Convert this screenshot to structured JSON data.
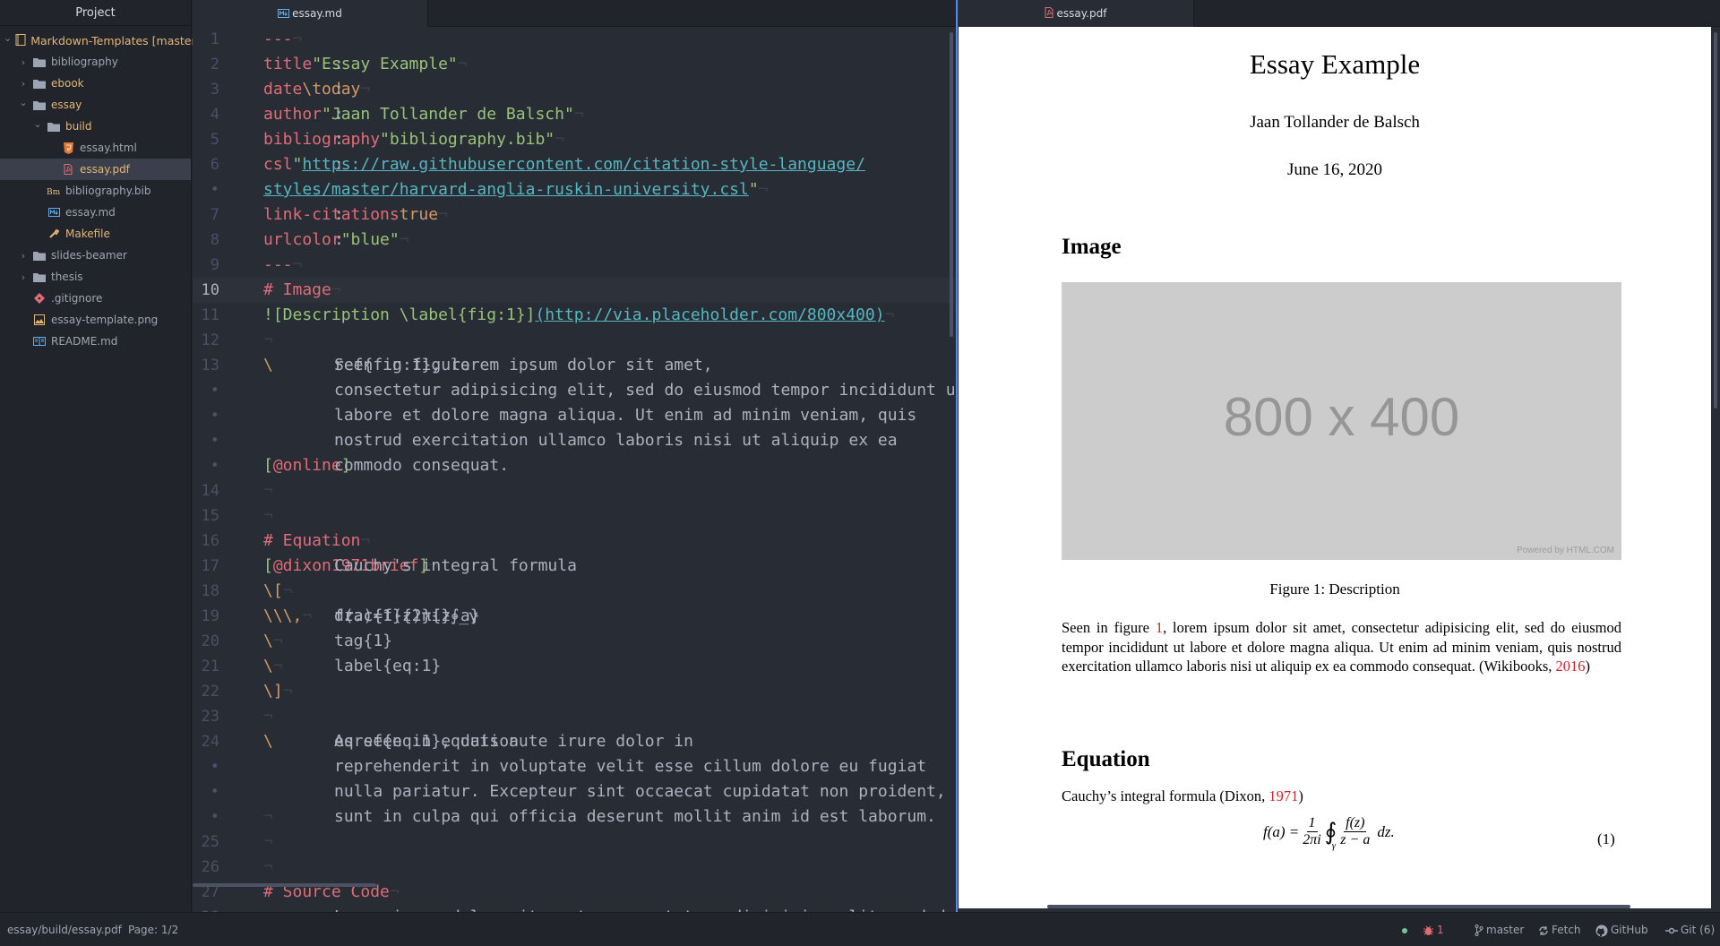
{
  "sidebar": {
    "title": "Project",
    "tree": [
      {
        "label": "Markdown-Templates [master]",
        "type": "repo",
        "level": 0,
        "chevron": "open",
        "style": "root"
      },
      {
        "label": "bibliography",
        "type": "folder",
        "level": 1,
        "chevron": "closed"
      },
      {
        "label": "ebook",
        "type": "folder",
        "level": 1,
        "chevron": "closed",
        "style": "orange"
      },
      {
        "label": "essay",
        "type": "folder",
        "level": 1,
        "chevron": "open",
        "style": "orange"
      },
      {
        "label": "build",
        "type": "folder",
        "level": 2,
        "chevron": "open",
        "style": "orange"
      },
      {
        "label": "essay.html",
        "type": "html",
        "level": 3
      },
      {
        "label": "essay.pdf",
        "type": "pdf",
        "level": 3,
        "selected": true,
        "style": "orange"
      },
      {
        "label": "bibliography.bib",
        "type": "bib",
        "level": 2
      },
      {
        "label": "essay.md",
        "type": "md",
        "level": 2
      },
      {
        "label": "Makefile",
        "type": "make",
        "level": 2,
        "style": "orange"
      },
      {
        "label": "slides-beamer",
        "type": "folder",
        "level": 1,
        "chevron": "closed"
      },
      {
        "label": "thesis",
        "type": "folder",
        "level": 1,
        "chevron": "closed"
      },
      {
        "label": ".gitignore",
        "type": "git",
        "level": 1
      },
      {
        "label": "essay-template.png",
        "type": "png",
        "level": 1
      },
      {
        "label": "README.md",
        "type": "readme",
        "level": 1
      }
    ]
  },
  "editor": {
    "tab_label": "essay.md",
    "active_line": "10",
    "lines": [
      {
        "n": "1",
        "seg": [
          [
            "head",
            "---"
          ],
          [
            "eol",
            "¬"
          ]
        ]
      },
      {
        "n": "2",
        "seg": [
          [
            "kw",
            "title"
          ],
          [
            "txt",
            ": "
          ],
          [
            "str",
            "\"Essay Example\""
          ],
          [
            "eol",
            "¬"
          ]
        ]
      },
      {
        "n": "3",
        "seg": [
          [
            "kw",
            "date"
          ],
          [
            "txt",
            ": "
          ],
          [
            "num",
            "\\today"
          ],
          [
            "eol",
            "¬"
          ]
        ]
      },
      {
        "n": "4",
        "seg": [
          [
            "kw",
            "author"
          ],
          [
            "txt",
            ": "
          ],
          [
            "str",
            "\"Jaan Tollander de Balsch\""
          ],
          [
            "eol",
            "¬"
          ]
        ]
      },
      {
        "n": "5",
        "seg": [
          [
            "kw",
            "bibliography"
          ],
          [
            "txt",
            ": "
          ],
          [
            "str",
            "\"bibliography.bib\""
          ],
          [
            "eol",
            "¬"
          ]
        ]
      },
      {
        "n": "6",
        "seg": [
          [
            "kw",
            "csl"
          ],
          [
            "txt",
            ": "
          ],
          [
            "str",
            "\""
          ],
          [
            "link",
            "https://raw.githubusercontent.com/citation-style-language/"
          ]
        ]
      },
      {
        "n": "•",
        "seg": [
          [
            "link",
            "styles/master/harvard-anglia-ruskin-university.csl"
          ],
          [
            "str",
            "\""
          ],
          [
            "eol",
            "¬"
          ]
        ]
      },
      {
        "n": "7",
        "seg": [
          [
            "kw",
            "link-citations"
          ],
          [
            "txt",
            ": "
          ],
          [
            "num",
            "true"
          ],
          [
            "eol",
            "¬"
          ]
        ]
      },
      {
        "n": "8",
        "seg": [
          [
            "kw",
            "urlcolor"
          ],
          [
            "txt",
            ": "
          ],
          [
            "str",
            "\"blue\""
          ],
          [
            "eol",
            "¬"
          ]
        ]
      },
      {
        "n": "9",
        "seg": [
          [
            "head",
            "---"
          ],
          [
            "eol",
            "¬"
          ]
        ]
      },
      {
        "n": "10",
        "seg": [
          [
            "head",
            "# Image"
          ],
          [
            "eol",
            "¬"
          ]
        ]
      },
      {
        "n": "11",
        "seg": [
          [
            "brk",
            "![Description \\label{fig:1}]"
          ],
          [
            "link",
            "(http://via.placeholder.com/800x400)"
          ],
          [
            "eol",
            "¬"
          ]
        ]
      },
      {
        "n": "12",
        "seg": [
          [
            "eol",
            "¬"
          ]
        ]
      },
      {
        "n": "13",
        "seg": [
          [
            "txt",
            "Seen in figure "
          ],
          [
            "esc",
            "\\"
          ],
          [
            "txt",
            "ref{fig:1}, lorem ipsum dolor sit amet,"
          ]
        ]
      },
      {
        "n": "•",
        "seg": [
          [
            "txt",
            "consectetur adipisicing elit, sed do eiusmod tempor incididunt ut"
          ]
        ]
      },
      {
        "n": "•",
        "seg": [
          [
            "txt",
            "labore et dolore magna aliqua. Ut enim ad minim veniam, quis"
          ]
        ]
      },
      {
        "n": "•",
        "seg": [
          [
            "txt",
            "nostrud exercitation ullamco laboris nisi ut aliquip ex ea"
          ]
        ]
      },
      {
        "n": "•",
        "seg": [
          [
            "txt",
            "commodo consequat. "
          ],
          [
            "brk",
            "["
          ],
          [
            "cite",
            "@online"
          ],
          [
            "brk",
            "]"
          ],
          [
            "eol",
            "¬"
          ]
        ]
      },
      {
        "n": "14",
        "seg": [
          [
            "eol",
            "¬"
          ]
        ]
      },
      {
        "n": "15",
        "seg": [
          [
            "eol",
            "¬"
          ]
        ]
      },
      {
        "n": "16",
        "seg": [
          [
            "head",
            "# Equation"
          ],
          [
            "eol",
            "¬"
          ]
        ]
      },
      {
        "n": "17",
        "seg": [
          [
            "txt",
            "Cauchy's integral formula "
          ],
          [
            "brk",
            "["
          ],
          [
            "cite",
            "@dixon1971brief"
          ],
          [
            "brk",
            "]"
          ],
          [
            "eol",
            "¬"
          ]
        ]
      },
      {
        "n": "18",
        "seg": [
          [
            "esc",
            "\\["
          ],
          [
            "eol",
            "¬"
          ]
        ]
      },
      {
        "n": "19",
        "seg": [
          [
            "txt",
            "f(a)="
          ],
          [
            "esc",
            "\\"
          ],
          [
            "txt",
            "frac{1}{2πi}∮_γ"
          ],
          [
            "esc",
            "\\"
          ],
          [
            "txt",
            "frac{f(z)}{z-a}"
          ],
          [
            "esc",
            "\\,"
          ],
          [
            "txt",
            "dz."
          ],
          [
            "eol",
            "¬"
          ]
        ]
      },
      {
        "n": "20",
        "seg": [
          [
            "esc",
            "\\"
          ],
          [
            "txt",
            "tag{1}"
          ],
          [
            "eol",
            "¬"
          ]
        ]
      },
      {
        "n": "21",
        "seg": [
          [
            "esc",
            "\\"
          ],
          [
            "txt",
            "label{eq:1}"
          ],
          [
            "eol",
            "¬"
          ]
        ]
      },
      {
        "n": "22",
        "seg": [
          [
            "esc",
            "\\]"
          ],
          [
            "eol",
            "¬"
          ]
        ]
      },
      {
        "n": "23",
        "seg": [
          [
            "eol",
            "¬"
          ]
        ]
      },
      {
        "n": "24",
        "seg": [
          [
            "txt",
            "As seen in equation "
          ],
          [
            "esc",
            "\\"
          ],
          [
            "txt",
            "eqref{eq:1}, duis aute irure dolor in"
          ]
        ]
      },
      {
        "n": "•",
        "seg": [
          [
            "txt",
            "reprehenderit in voluptate velit esse cillum dolore eu fugiat"
          ]
        ]
      },
      {
        "n": "•",
        "seg": [
          [
            "txt",
            "nulla pariatur. Excepteur sint occaecat cupidatat non proident,"
          ]
        ]
      },
      {
        "n": "•",
        "seg": [
          [
            "txt",
            "sunt in culpa qui officia deserunt mollit anim id est laborum."
          ],
          [
            "eol",
            "¬"
          ]
        ]
      },
      {
        "n": "25",
        "seg": [
          [
            "eol",
            "¬"
          ]
        ]
      },
      {
        "n": "26",
        "seg": [
          [
            "eol",
            "¬"
          ]
        ]
      },
      {
        "n": "27",
        "seg": [
          [
            "head",
            "# Source Code"
          ],
          [
            "eol",
            "¬"
          ]
        ]
      },
      {
        "n": "28",
        "seg": [
          [
            "txt",
            "Lorem ipsum dolor sit amet, consectetur adipisicing elit, sed do"
          ]
        ]
      }
    ]
  },
  "pdf": {
    "tab_label": "essay.pdf",
    "title": "Essay Example",
    "author": "Jaan Tollander de Balsch",
    "date": "June 16, 2020",
    "section1": "Image",
    "image_text": "800 x 400",
    "image_powered": "Powered by HTML.COM",
    "caption": "Figure 1: Description",
    "para1_a": "Seen in figure ",
    "para1_ref": "1",
    "para1_b": ", lorem ipsum dolor sit amet, consectetur adipisicing elit, sed do eiusmod tempor incididunt ut labore et dolore magna aliqua. Ut enim ad minim veniam, quis nostrud exercitation ullamco laboris nisi ut aliquip ex ea commodo consequat. (Wikibooks, ",
    "para1_year": "2016",
    "para1_c": ")",
    "section2": "Equation",
    "para2_a": "Cauchy’s integral formula (Dixon, ",
    "para2_year": "1971",
    "para2_b": ")",
    "eq_lhs": "f(a) =",
    "eq_num1": "1",
    "eq_den1": "2πi",
    "eq_int": "∮",
    "eq_sub": "γ",
    "eq_num2": "f(z)",
    "eq_den2": "z − a",
    "eq_tail": "dz.",
    "eq_tag": "(1)"
  },
  "status": {
    "file_path": "essay/build/essay.pdf",
    "page": "Page: 1/2",
    "issues": "1",
    "branch": "master",
    "fetch": "Fetch",
    "github": "GitHub",
    "git": "Git (6)"
  }
}
